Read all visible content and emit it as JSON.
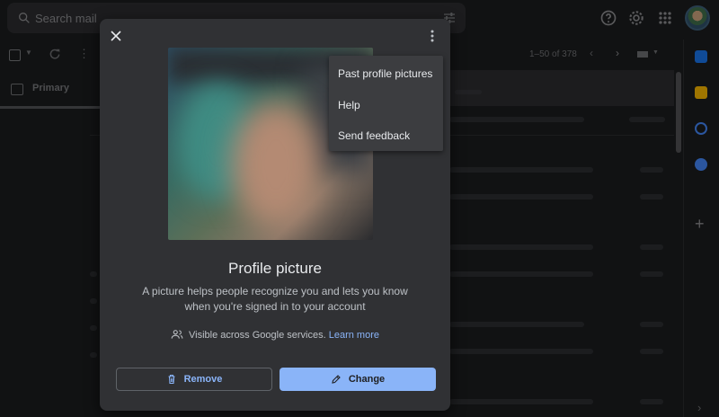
{
  "search": {
    "placeholder": "Search mail"
  },
  "toolbar": {
    "pager": "1–50 of 378"
  },
  "tabs": {
    "primary": "Primary"
  },
  "modal": {
    "title": "Profile picture",
    "description": "A picture helps people recognize you and lets you know when you're signed in to your account",
    "visibility_text": "Visible across Google services.",
    "learn_more": "Learn more",
    "remove_label": "Remove",
    "change_label": "Change"
  },
  "menu": {
    "items": [
      {
        "label": "Past profile pictures"
      },
      {
        "label": "Help"
      },
      {
        "label": "Send feedback"
      }
    ]
  },
  "icons": {
    "search": "search-icon",
    "tune": "tune-icon",
    "help": "help-icon",
    "settings": "gear-icon",
    "apps": "apps-grid-icon",
    "close": "close-icon",
    "more": "more-vert-icon",
    "people": "people-icon",
    "trash": "trash-icon",
    "pencil": "pencil-icon"
  },
  "colors": {
    "accent": "#8ab4f8",
    "modal_bg": "#303134",
    "menu_bg": "#3c3d40",
    "page_bg": "#1b1c1e"
  }
}
